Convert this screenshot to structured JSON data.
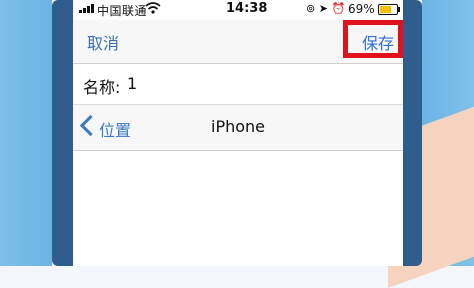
{
  "status_bar": {
    "carrier": "中国联通",
    "time": "14:38",
    "battery_percent": "69%",
    "icons": [
      "signal-icon",
      "wifi-icon",
      "location-icon",
      "alarm-icon",
      "orientation-lock-icon",
      "battery-icon"
    ]
  },
  "nav": {
    "cancel_label": "取消",
    "save_label": "保存",
    "highlight_color": "#e1121b"
  },
  "form": {
    "name_label": "名称:",
    "name_value": "1"
  },
  "location_nav": {
    "back_label": "位置",
    "title": "iPhone"
  },
  "colors": {
    "accent": "#3b78c8",
    "background_blue": "#6bb4e2",
    "device_frame": "#2f5e8e"
  }
}
